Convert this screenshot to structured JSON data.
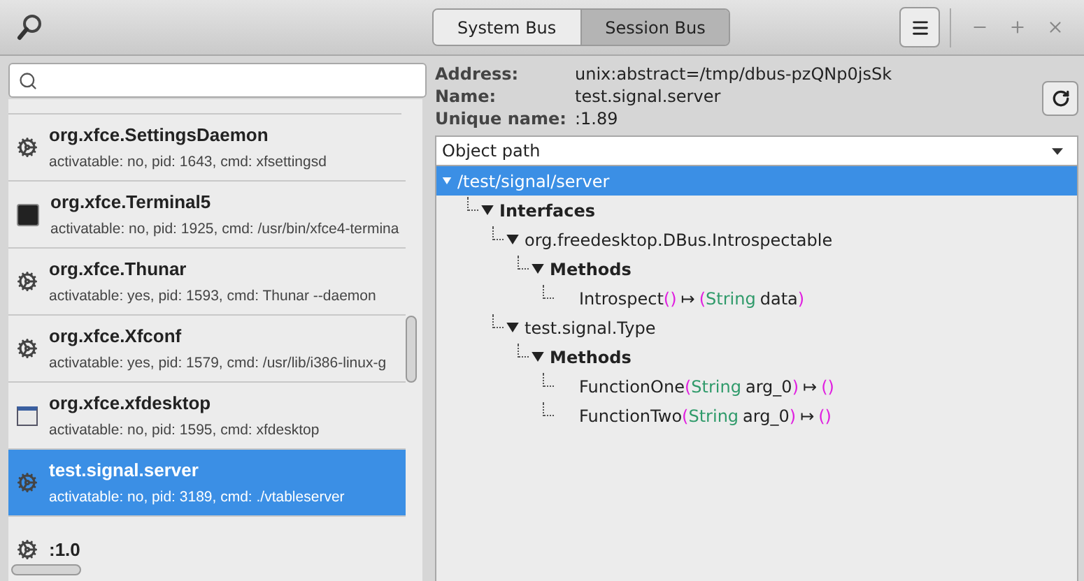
{
  "titlebar": {
    "bus_tabs": [
      {
        "label": "System Bus",
        "selected": false
      },
      {
        "label": "Session Bus",
        "selected": true
      }
    ]
  },
  "services": [
    {
      "name": "org.xfce.SettingsDaemon",
      "details": "activatable: no, pid: 1643, cmd: xfsettingsd",
      "kind": "gear",
      "selected": false
    },
    {
      "name": "org.xfce.Terminal5",
      "details": "activatable: no, pid: 1925, cmd: /usr/bin/xfce4-termina",
      "kind": "terminal",
      "selected": false
    },
    {
      "name": "org.xfce.Thunar",
      "details": "activatable: yes, pid: 1593, cmd: Thunar --daemon",
      "kind": "gear",
      "selected": false
    },
    {
      "name": "org.xfce.Xfconf",
      "details": "activatable: yes, pid: 1579, cmd: /usr/lib/i386-linux-g",
      "kind": "gear",
      "selected": false
    },
    {
      "name": "org.xfce.xfdesktop",
      "details": "activatable: no, pid: 1595, cmd: xfdesktop",
      "kind": "window",
      "selected": false
    },
    {
      "name": "test.signal.server",
      "details": "activatable: no, pid: 3189, cmd: ./vtableserver",
      "kind": "gear",
      "selected": true
    },
    {
      "name": ":1.0",
      "kind": "gear",
      "selected": false
    }
  ],
  "info": [
    {
      "label": "Address:",
      "value": "unix:abstract=/tmp/dbus-pzQNp0jsSk"
    },
    {
      "label": "Name:",
      "value": "test.signal.server"
    },
    {
      "label": "Unique name:",
      "value": ":1.89"
    }
  ],
  "view_select": {
    "value": "Object path"
  },
  "tree": [
    {
      "kind": "path",
      "text": "/test/signal/server",
      "selected": true,
      "expanded": true,
      "children": [
        {
          "kind": "group",
          "text": "Interfaces",
          "selected": false,
          "expanded": true,
          "children": [
            {
              "kind": "interface",
              "text": "org.freedesktop.DBus.Introspectable",
              "selected": false,
              "expanded": true,
              "children": [
                {
                  "kind": "group",
                  "text": "Methods",
                  "selected": false,
                  "expanded": true,
                  "children": [
                    {
                      "kind": "method",
                      "selected": false,
                      "parts": [
                        {
                          "kind": "name",
                          "text": "Introspect"
                        },
                        {
                          "kind": "punct",
                          "text": "()"
                        },
                        {
                          "kind": "arrow",
                          "text": "↦"
                        },
                        {
                          "kind": "punct",
                          "text": "("
                        },
                        {
                          "kind": "type",
                          "text": "String"
                        },
                        {
                          "kind": "arg",
                          "text": "data"
                        },
                        {
                          "kind": "punct",
                          "text": ")"
                        }
                      ]
                    }
                  ]
                }
              ]
            },
            {
              "kind": "interface",
              "text": "test.signal.Type",
              "selected": false,
              "expanded": true,
              "children": [
                {
                  "kind": "group",
                  "text": "Methods",
                  "selected": false,
                  "expanded": true,
                  "children": [
                    {
                      "kind": "method",
                      "selected": false,
                      "parts": [
                        {
                          "kind": "name",
                          "text": "FunctionOne"
                        },
                        {
                          "kind": "punct",
                          "text": "("
                        },
                        {
                          "kind": "type",
                          "text": "String"
                        },
                        {
                          "kind": "arg",
                          "text": "arg_0"
                        },
                        {
                          "kind": "punct",
                          "text": ")"
                        },
                        {
                          "kind": "arrow",
                          "text": "↦"
                        },
                        {
                          "kind": "punct",
                          "text": "()"
                        }
                      ]
                    },
                    {
                      "kind": "method",
                      "selected": false,
                      "parts": [
                        {
                          "kind": "name",
                          "text": "FunctionTwo"
                        },
                        {
                          "kind": "punct",
                          "text": "("
                        },
                        {
                          "kind": "type",
                          "text": "String"
                        },
                        {
                          "kind": "arg",
                          "text": "arg_0"
                        },
                        {
                          "kind": "punct",
                          "text": ")"
                        },
                        {
                          "kind": "arrow",
                          "text": "↦"
                        },
                        {
                          "kind": "punct",
                          "text": "()"
                        }
                      ]
                    }
                  ]
                }
              ]
            }
          ]
        }
      ]
    }
  ]
}
